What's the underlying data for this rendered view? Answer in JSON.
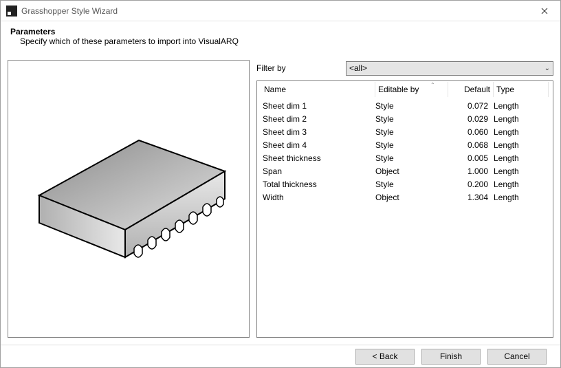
{
  "window": {
    "title": "Grasshopper Style Wizard"
  },
  "header": {
    "title": "Parameters",
    "description": "Specify which of these parameters to import into VisualARQ"
  },
  "filter": {
    "label": "Filter by",
    "selected": "<all>"
  },
  "columns": {
    "name": "Name",
    "editable": "Editable by",
    "default": "Default",
    "type": "Type"
  },
  "rows": [
    {
      "name": "Sheet dim 1",
      "editable": "Style",
      "default": "0.072",
      "type": "Length"
    },
    {
      "name": "Sheet dim 2",
      "editable": "Style",
      "default": "0.029",
      "type": "Length"
    },
    {
      "name": "Sheet dim 3",
      "editable": "Style",
      "default": "0.060",
      "type": "Length"
    },
    {
      "name": "Sheet dim 4",
      "editable": "Style",
      "default": "0.068",
      "type": "Length"
    },
    {
      "name": "Sheet thickness",
      "editable": "Style",
      "default": "0.005",
      "type": "Length"
    },
    {
      "name": "Span",
      "editable": "Object",
      "default": "1.000",
      "type": "Length"
    },
    {
      "name": "Total thickness",
      "editable": "Style",
      "default": "0.200",
      "type": "Length"
    },
    {
      "name": "Width",
      "editable": "Object",
      "default": "1.304",
      "type": "Length"
    }
  ],
  "buttons": {
    "back": "< Back",
    "finish": "Finish",
    "cancel": "Cancel"
  }
}
